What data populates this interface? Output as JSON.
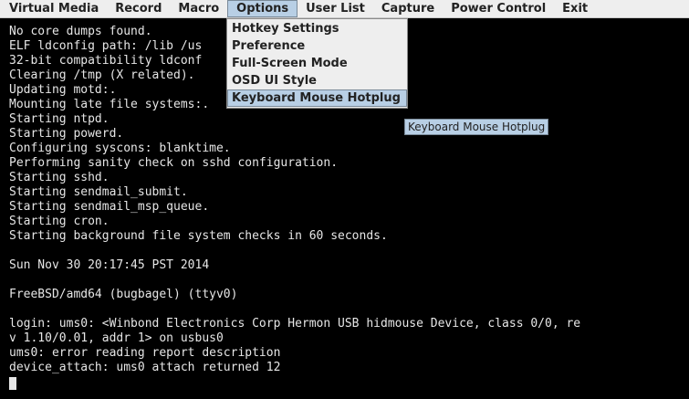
{
  "menubar": {
    "items": [
      {
        "label": "Virtual Media"
      },
      {
        "label": "Record"
      },
      {
        "label": "Macro"
      },
      {
        "label": "Options"
      },
      {
        "label": "User List"
      },
      {
        "label": "Capture"
      },
      {
        "label": "Power Control"
      },
      {
        "label": "Exit"
      }
    ]
  },
  "options_menu": {
    "items": [
      {
        "label": "Hotkey Settings"
      },
      {
        "label": "Preference"
      },
      {
        "label": "Full-Screen Mode"
      },
      {
        "label": "OSD UI Style"
      },
      {
        "label": "Keyboard Mouse Hotplug"
      }
    ]
  },
  "tooltip": {
    "text": "Keyboard Mouse Hotplug"
  },
  "console": {
    "lines": [
      "No core dumps found.",
      "ELF ldconfig path: /lib /us",
      "32-bit compatibility ldconf",
      "Clearing /tmp (X related).",
      "Updating motd:.",
      "Mounting late file systems:.",
      "Starting ntpd.",
      "Starting powerd.",
      "Configuring syscons: blanktime.",
      "Performing sanity check on sshd configuration.",
      "Starting sshd.",
      "Starting sendmail_submit.",
      "Starting sendmail_msp_queue.",
      "Starting cron.",
      "Starting background file system checks in 60 seconds.",
      "",
      "Sun Nov 30 20:17:45 PST 2014",
      "",
      "FreeBSD/amd64 (bugbagel) (ttyv0)",
      "",
      "login: ums0: <Winbond Electronics Corp Hermon USB hidmouse Device, class 0/0, re",
      "v 1.10/0.01, addr 1> on usbus0",
      "ums0: error reading report description",
      "device_attach: ums0 attach returned 12"
    ]
  }
}
